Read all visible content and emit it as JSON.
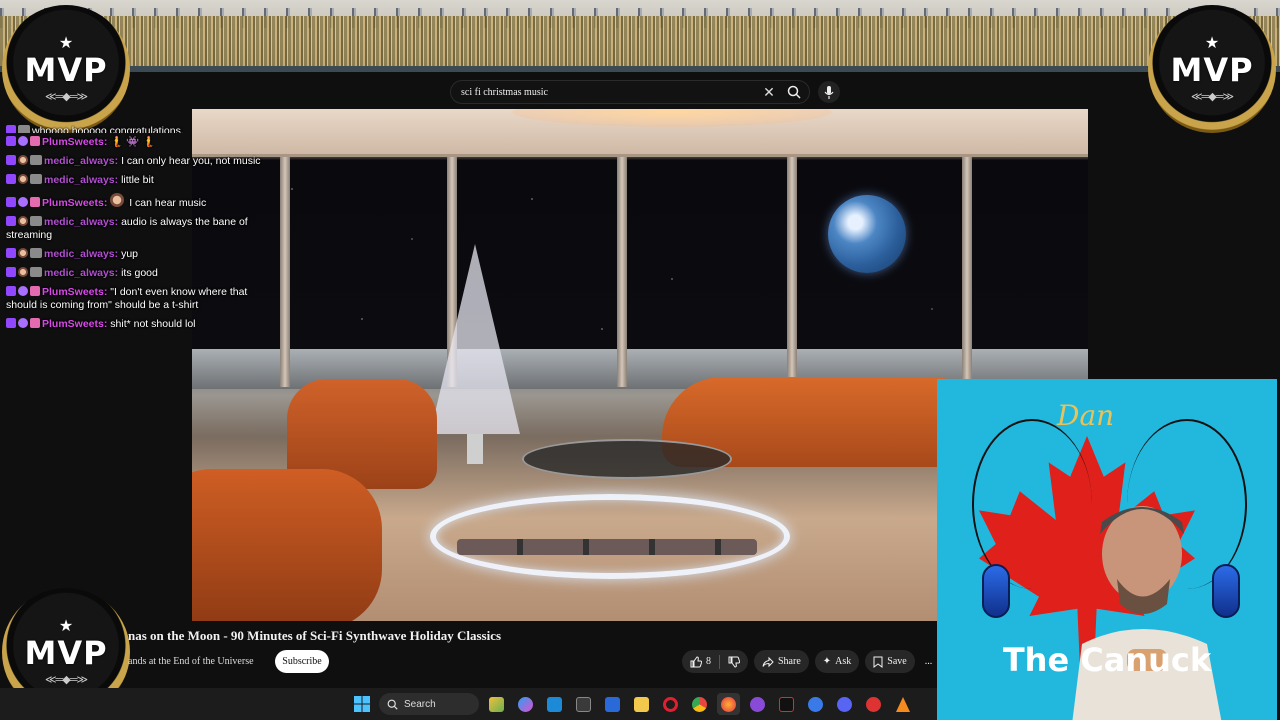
{
  "banner": {
    "badge_text": "MVP"
  },
  "chat": {
    "partial_top": "whoooo hooooo congratulations.",
    "lines": [
      {
        "user": "PlumSweets",
        "message": "🧜 👾 🧜"
      },
      {
        "user": "medic_always",
        "message": "I can only hear you, not music"
      },
      {
        "user": "medic_always",
        "message": "little bit"
      },
      {
        "user": "PlumSweets",
        "message": "I can hear music"
      },
      {
        "user": "medic_always",
        "message": "audio is always the bane of streaming"
      },
      {
        "user": "medic_always",
        "message": "yup"
      },
      {
        "user": "medic_always",
        "message": "its good"
      },
      {
        "user": "PlumSweets",
        "message": "\"I don't even know where that should is coming from\" should be a t-shirt"
      },
      {
        "user": "PlumSweets",
        "message": "shit* not should lol"
      }
    ]
  },
  "search": {
    "query": "sci fi christmas music"
  },
  "video": {
    "title": "nas on the Moon - 90 Minutes of Sci-Fi Synthwave Holiday Classics",
    "channel": "ands at the End of the Universe",
    "subscribe_label": "Subscribe",
    "like_count": "8",
    "share_label": "Share",
    "ask_label": "Ask",
    "save_label": "Save",
    "more_label": "..."
  },
  "webcam": {
    "name": "Dan",
    "label": "The Canuck"
  },
  "taskbar": {
    "search_placeholder": "Search"
  },
  "colors": {
    "accent_red": "#e0201a",
    "cam_bg": "#22b8de",
    "chat_user": "#d84ae8"
  }
}
